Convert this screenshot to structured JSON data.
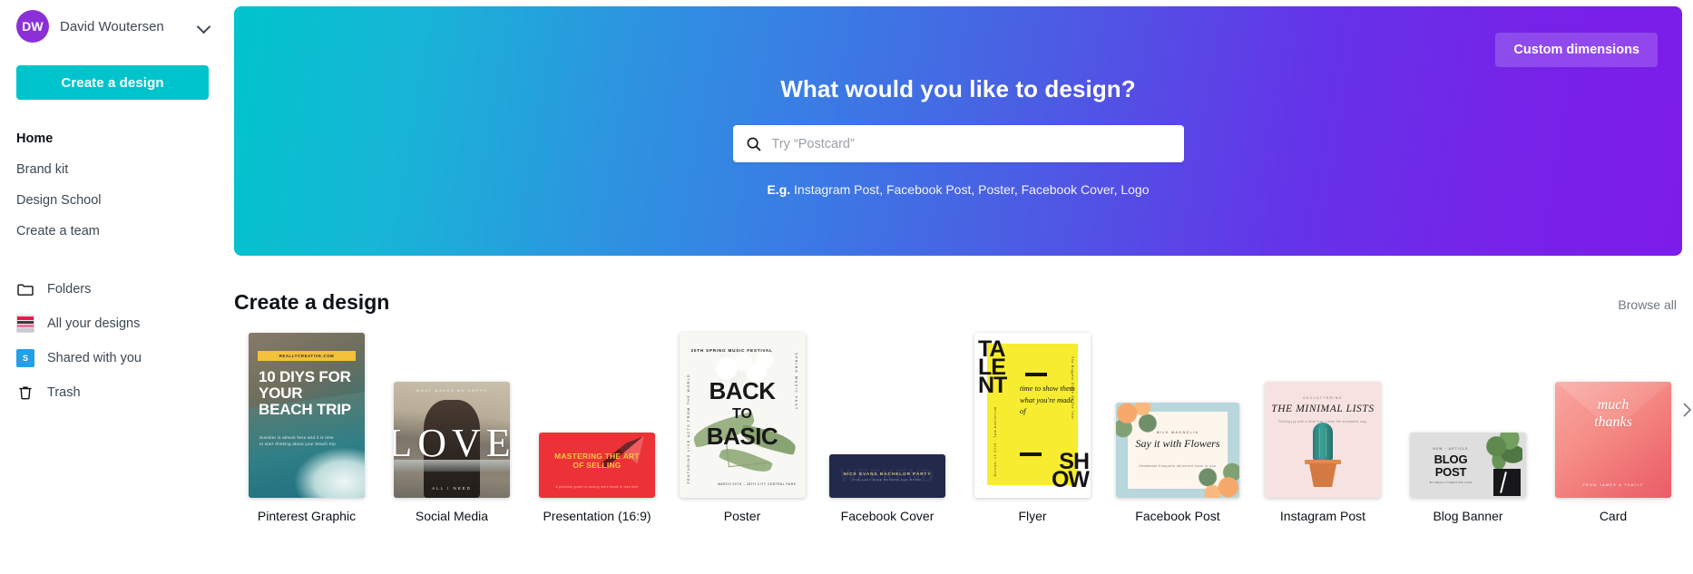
{
  "sidebar": {
    "account": {
      "initials": "DW",
      "name": "David Woutersen",
      "chevron_icon": "chevron-down-icon"
    },
    "create_button": "Create a design",
    "nav_top": [
      {
        "label": "Home",
        "active": true
      },
      {
        "label": "Brand kit",
        "active": false
      },
      {
        "label": "Design School",
        "active": false
      },
      {
        "label": "Create a team",
        "active": false
      }
    ],
    "nav_bottom": [
      {
        "label": "Folders",
        "icon": "folder-icon"
      },
      {
        "label": "All your designs",
        "icon": "designs-thumbnail-icon"
      },
      {
        "label": "Shared with you",
        "icon": "shared-icon",
        "badge": "S"
      },
      {
        "label": "Trash",
        "icon": "trash-icon"
      }
    ]
  },
  "hero": {
    "custom_dimensions": "Custom dimensions",
    "title": "What would you like to design?",
    "search": {
      "placeholder": "Try “Postcard”",
      "value": "",
      "icon": "search-icon"
    },
    "examples_label": "E.g.",
    "examples": [
      "Instagram Post",
      "Facebook Post",
      "Poster",
      "Facebook Cover",
      "Logo"
    ]
  },
  "section": {
    "title": "Create a design",
    "browse_all": "Browse all",
    "next_arrow_icon": "chevron-right-icon"
  },
  "cards": [
    {
      "label": "Pinterest Graphic",
      "art": {
        "band": "REALLYCREATIVE.COM",
        "headline": "10 DIYS FOR YOUR BEACH TRIP",
        "sub": "Summer is almost here and it is time to start thinking about your beach trip",
        "colors": [
          "#f4c13b",
          "#2f7f87",
          "#6d6257"
        ]
      }
    },
    {
      "label": "Social Media",
      "art": {
        "top": "WHAT MAKES ME HAPPY",
        "word": "LOVE",
        "bottom": "ALL I NEED",
        "colors": [
          "#b8ad97",
          "#2e2722"
        ]
      }
    },
    {
      "label": "Presentation (16:9)",
      "art": {
        "headline": "MASTERING THE ART OF SELLING",
        "sub": "A practical guide to closing more deals in less time",
        "colors": [
          "#ec3237",
          "#f5c842"
        ]
      }
    },
    {
      "label": "Poster",
      "art": {
        "header": "20TH SPRING MUSIC FESTIVAL",
        "headline": "BACK TO BASIC",
        "side_right": "SPRING MUSIC FEST",
        "side_left": "FEATURING LIVE ACTS FROM THE WORLD",
        "footer": "MARCH 20TH – 28TH\nCITY CENTRAL PARK",
        "colors": [
          "#f7f7f3",
          "#93ab7b"
        ]
      }
    },
    {
      "label": "Facebook Cover",
      "art": {
        "ghost": "WEEKEND",
        "headline": "NICK EVANS  BACHELOR PARTY",
        "sub": "THE LAST RIDE BEFORE THE BRIDE",
        "colors": [
          "#23294a",
          "#d9c68a"
        ]
      }
    },
    {
      "label": "Flyer",
      "art": {
        "word_left": "TALENT",
        "word_right": "SHOW",
        "middle": "time to show them what you're made of",
        "side_right": "The Biggest Stage Of The Year",
        "side_left": "October 12 2019 · 7pm Auditorium",
        "colors": [
          "#f7ec2f",
          "#141414"
        ]
      }
    },
    {
      "label": "Facebook Post",
      "art": {
        "top": "MILK MAGNOLIA",
        "headline": "Say it with Flowers",
        "sub": "Handmade bouquets delivered fresh to you",
        "colors": [
          "#b8d7dd",
          "#f7a86b",
          "#fdf6ec"
        ]
      }
    },
    {
      "label": "Instagram Post",
      "art": {
        "top": "DECLUTTERING",
        "headline": "THE MINIMAL LISTS",
        "sub": "Finding joy with a little less. Learn the minimalist way.",
        "colors": [
          "#f6e3e1",
          "#3aa096",
          "#d4793f"
        ]
      }
    },
    {
      "label": "Blog Banner",
      "art": {
        "top": "NEW · ARTICLE",
        "headline": "BLOG POST",
        "sub": "BY REALLYCREATIVE.COM",
        "colors": [
          "#dedede",
          "#17171a"
        ]
      }
    },
    {
      "label": "Card",
      "art": {
        "headline": "much thanks",
        "bottom": "FROM JAMES & FAMILY",
        "colors": [
          "#f9a6a0",
          "#ea5c69"
        ]
      }
    }
  ]
}
